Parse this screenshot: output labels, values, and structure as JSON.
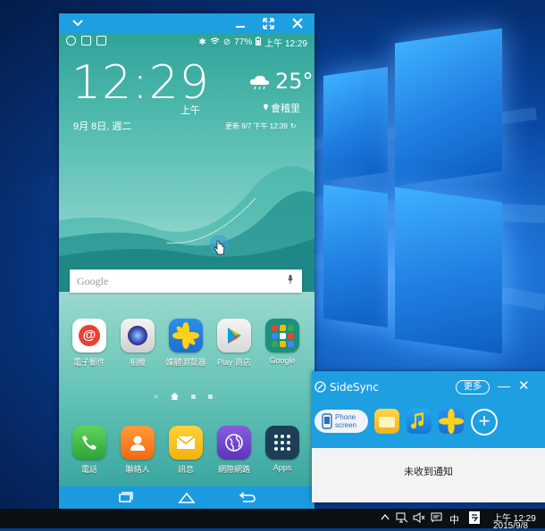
{
  "phone": {
    "status": {
      "battery": "77%",
      "time": "上午 12:29"
    },
    "lockscreen": {
      "clock": "12:29",
      "ampm": "上午",
      "date": "9月 8日, 週二",
      "temperature": "25°",
      "location": "會稽里",
      "updated": "更新 9/7 下午 12:39"
    },
    "search": {
      "placeholder": "Google"
    },
    "apps": [
      {
        "label": "電子郵件"
      },
      {
        "label": "相機"
      },
      {
        "label": "媒體瀏覽器"
      },
      {
        "label": "Play 商店"
      },
      {
        "label": "Google"
      }
    ],
    "dock": [
      {
        "label": "電話"
      },
      {
        "label": "聯絡人"
      },
      {
        "label": "訊息"
      },
      {
        "label": "網際網路"
      },
      {
        "label": "Apps"
      }
    ]
  },
  "sidesync": {
    "title": "SideSync",
    "more": "更多",
    "phone_screen": "Phone\nscreen",
    "phone_screen_l1": "Phone",
    "phone_screen_l2": "screen",
    "empty_message": "未收到通知"
  },
  "taskbar": {
    "ime": "中",
    "time": "上午 12:29",
    "date": "2015/9/8"
  },
  "colors": {
    "window_blue": "#1e9fe2",
    "desktop_blue": "#1f74d6"
  }
}
